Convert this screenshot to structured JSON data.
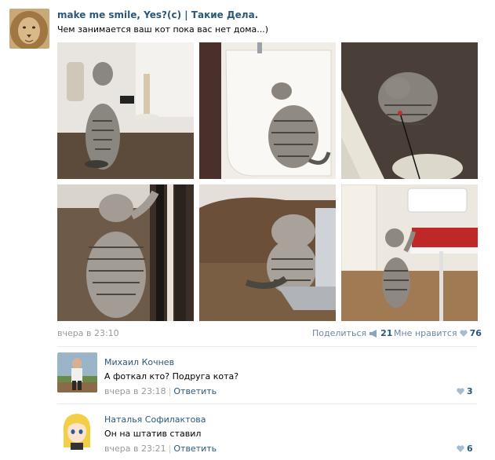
{
  "post": {
    "author": "make me smile, Yes?(c) | Такие Дела.",
    "text": "Чем занимается ваш кот пока вас нет дома...)",
    "date": "вчера в 23:10",
    "share_label": "Поделиться",
    "share_count": "21",
    "like_label": "Мне нравится",
    "like_count": "76",
    "avatar_icon": "lion-avatar",
    "photos_icon": "cat-photo"
  },
  "comments": [
    {
      "author": "Михаил Кочнев",
      "text": "А фоткал кто? Подруга кота?",
      "date": "вчера в 23:18",
      "reply": "Ответить",
      "likes": "3"
    },
    {
      "author": "Наталья Софилактова",
      "text": "Он на штатив ставил",
      "date": "вчера в 23:21",
      "reply": "Ответить",
      "likes": "6"
    }
  ],
  "colors": {
    "link": "#2b587a",
    "muted": "#999999",
    "action": "#6b87a6"
  }
}
